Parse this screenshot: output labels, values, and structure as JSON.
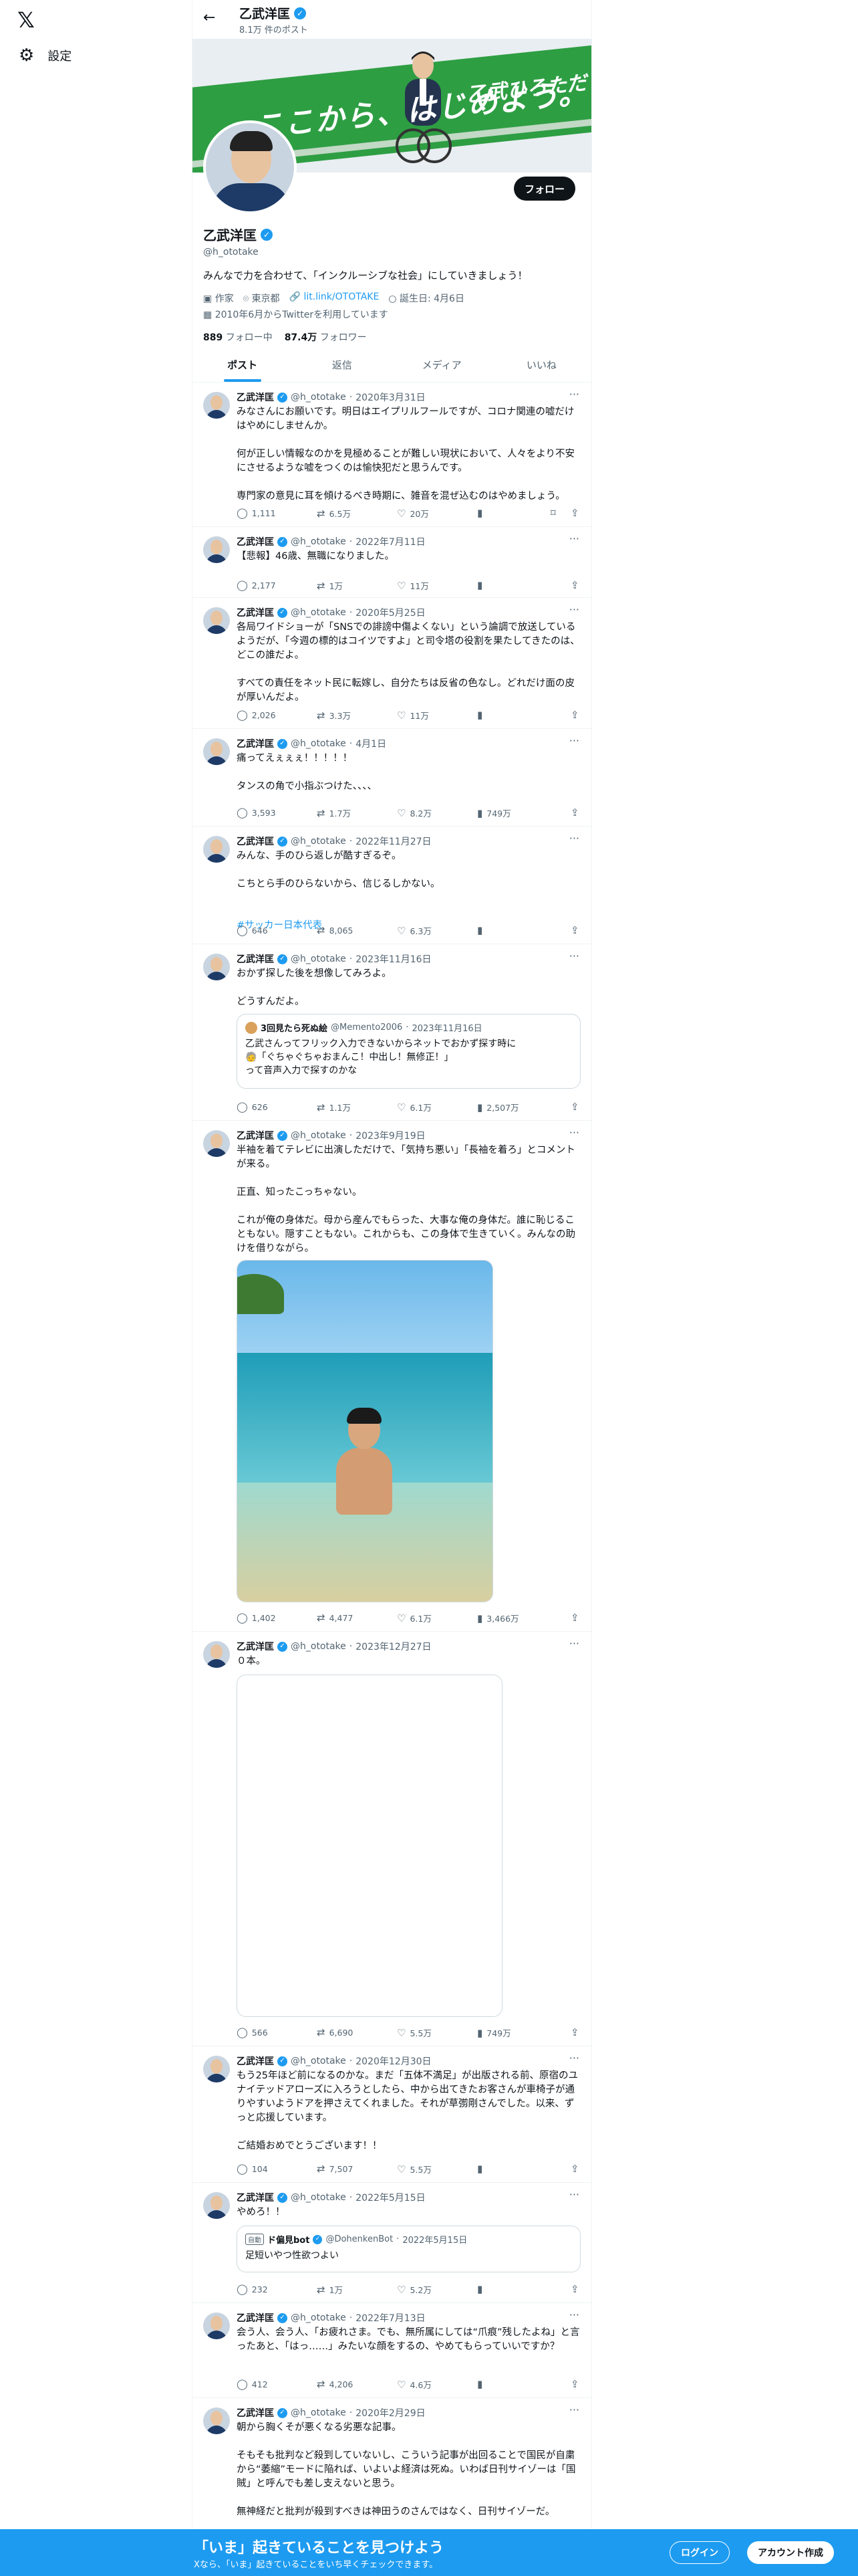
{
  "nav": {
    "logo": "𝕏",
    "settings_label": "設定",
    "settings_icon": "gear-icon"
  },
  "topbar": {
    "name": "乙武洋匡",
    "post_count": "8.1万 件のポスト"
  },
  "banner": {
    "slogan": "ここから、はじめよう。",
    "name": "乙武ひろただ"
  },
  "profile": {
    "name": "乙武洋匡",
    "handle": "@h_ototake",
    "follow_button": "フォロー",
    "bio": "みんなで力を合わせて、「インクルーシブな社会」にしていきましょう！",
    "job": "作家",
    "location": "東京都",
    "link": "lit.link/OTOTAKE",
    "birthday": "誕生日: 4月6日",
    "joined": "2010年6月からTwitterを利用しています",
    "following_count": "889",
    "following_label": "フォロー中",
    "followers_count": "87.4万",
    "followers_label": "フォロワー"
  },
  "tabs": [
    "ポスト",
    "返信",
    "メディア",
    "いいね"
  ],
  "posts": [
    {
      "name": "乙武洋匡",
      "handle": "@h_ototake",
      "date": "2020年3月31日",
      "text": "みなさんにお願いです。明日はエイプリルフールですが、コロナ関連の嘘だけはやめにしませんか。\n\n何が正しい情報なのかを見極めることが難しい現状において、人々をより不安にさせるような嘘をつくのは愉快犯だと思うんです。\n\n専門家の意見に耳を傾けるべき時期に、雑音を混ぜ込むのはやめましょう。",
      "reply": "1,111",
      "repost": "6.5万",
      "like": "20万",
      "views": ""
    },
    {
      "name": "乙武洋匡",
      "handle": "@h_ototake",
      "date": "2022年7月11日",
      "text": "【悲報】46歳、無職になりました。",
      "reply": "2,177",
      "repost": "1万",
      "like": "11万",
      "views": ""
    },
    {
      "name": "乙武洋匡",
      "handle": "@h_ototake",
      "date": "2020年5月25日",
      "text": "各局ワイドショーが「SNSでの誹謗中傷よくない」という論調で放送しているようだが、「今週の標的はコイツですよ」と司令塔の役割を果たしてきたのは、どこの誰だよ。\n\nすべての責任をネット民に転嫁し、自分たちは反省の色なし。どれだけ面の皮が厚いんだよ。",
      "reply": "2,026",
      "repost": "3.3万",
      "like": "11万",
      "views": ""
    },
    {
      "name": "乙武洋匡",
      "handle": "@h_ototake",
      "date": "4月1日",
      "text": "痛ってえぇぇぇ！！！！！\n\nタンスの角で小指ぶつけた、、、、",
      "reply": "3,593",
      "repost": "1.7万",
      "like": "8.2万",
      "views": "749万"
    },
    {
      "name": "乙武洋匡",
      "handle": "@h_ototake",
      "date": "2022年11月27日",
      "text": "みんな、手のひら返しが酷すぎるぞ。\n\nこちとら手のひらないから、信じるしかない。",
      "hashtag": "#サッカー日本代表",
      "reply": "646",
      "repost": "8,065",
      "like": "6.3万",
      "views": ""
    },
    {
      "name": "乙武洋匡",
      "handle": "@h_ototake",
      "date": "2023年11月16日",
      "text": "おかず探した後を想像してみろよ。\n\nどうすんだよ。",
      "quote": {
        "name": "3回見たら死ぬ絵",
        "handle": "@Memento2006",
        "date": "2023年11月16日",
        "text": "乙武さんってフリック入力できないからネットでおかず探す時に\n🧓「ぐちゃぐちゃおまんこ！中出し！無修正！」\nって音声入力で探すのかな"
      },
      "reply": "626",
      "repost": "1.1万",
      "like": "6.1万",
      "views": "2,507万"
    },
    {
      "name": "乙武洋匡",
      "handle": "@h_ototake",
      "date": "2023年9月19日",
      "text": "半袖を着てテレビに出演しただけで、「気持ち悪い」「長袖を着ろ」とコメントが来る。\n\n正直、知ったこっちゃない。\n\nこれが俺の身体だ。母から産んでもらった、大事な俺の身体だ。誰に恥じることもない。隠すこともない。これからも、この身体で生きていく。みんなの助けを借りながら。",
      "reply": "1,402",
      "repost": "4,477",
      "like": "6.1万",
      "views": "3,466万"
    },
    {
      "name": "乙武洋匡",
      "handle": "@h_ototake",
      "date": "2023年12月27日",
      "text": "０本。",
      "reply": "566",
      "repost": "6,690",
      "like": "5.5万",
      "views": "749万"
    },
    {
      "name": "乙武洋匡",
      "handle": "@h_ototake",
      "date": "2020年12月30日",
      "text": "もう25年ほど前になるのかな。まだ「五体不満足」が出版される前、原宿のユナイテッドアローズに入ろうとしたら、中から出てきたお客さんが車椅子が通りやすいようドアを押さえてくれました。それが草彅剛さんでした。以来、ずっと応援しています。\n\nご結婚おめでとうございます！！",
      "reply": "104",
      "repost": "7,507",
      "like": "5.5万",
      "views": ""
    },
    {
      "name": "乙武洋匡",
      "handle": "@h_ototake",
      "date": "2022年5月15日",
      "text": "やめろ！！",
      "quote": {
        "tag": "自動",
        "name": "ド偏見bot",
        "handle": "@DohenkenBot",
        "date": "2022年5月15日",
        "text": "足短いやつ性欲つよい"
      },
      "reply": "232",
      "repost": "1万",
      "like": "5.2万",
      "views": ""
    },
    {
      "name": "乙武洋匡",
      "handle": "@h_ototake",
      "date": "2022年7月13日",
      "text": "会う人、会う人、「お疲れさま。でも、無所属にしては“爪痕”残したよね」と言ったあと、「はっ……」みたいな顔をするの、やめてもらっていいですか？",
      "reply": "412",
      "repost": "4,206",
      "like": "4.6万",
      "views": ""
    },
    {
      "name": "乙武洋匡",
      "handle": "@h_ototake",
      "date": "2020年2月29日",
      "text": "朝から胸くそが悪くなる劣悪な記事。\n\nそもそも批判など殺到していないし、こういう記事が出回ることで国民が自粛から“萎縮”モードに陥れば、いよいよ経済は死ぬ。いわば日刊サイゾーは「国賊」と呼んでも差し支えないと思う。\n\n無神経だと批判が殺到すべきは神田うのさんではなく、日刊サイゾーだ。",
      "reply": "",
      "repost": "",
      "like": "",
      "views": ""
    }
  ],
  "bottom": {
    "title": "「いま」起きていることを見つけよう",
    "subtitle": "Xなら、「いま」起きていることをいち早くチェックできます。",
    "login": "ログイン",
    "signup": "アカウント作成"
  },
  "colors": {
    "accent": "#1d9bf0",
    "banner_green": "#2e9e43"
  }
}
